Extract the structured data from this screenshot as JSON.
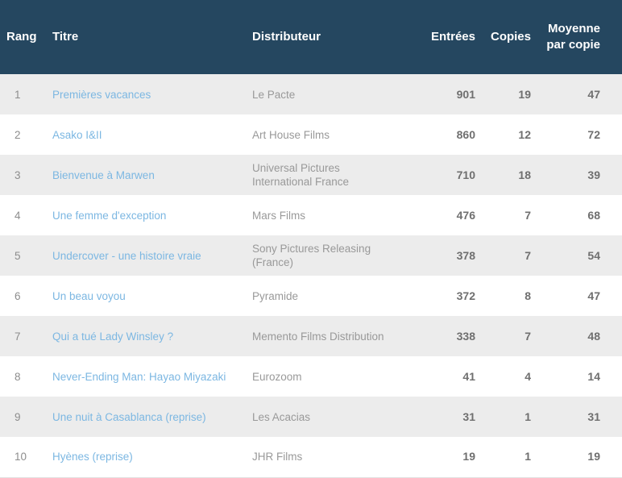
{
  "table": {
    "columns": {
      "rang": "Rang",
      "titre": "Titre",
      "distributeur": "Distributeur",
      "entrees": "Entrées",
      "copies": "Copies",
      "moyenne_line1": "Moyenne",
      "moyenne_line2": "par copie"
    },
    "colors": {
      "header_bg": "#254760",
      "header_text": "#ffffff",
      "row_odd_bg": "#ececec",
      "row_even_bg": "#ffffff",
      "link": "#7cb7e2",
      "rank_text": "#8d8d8d",
      "distributor_text": "#999999",
      "number_text": "#6f6f6f"
    },
    "rows": [
      {
        "rang": "1",
        "titre": "Premières vacances",
        "distributeur": [
          "Le Pacte"
        ],
        "entrees": "901",
        "copies": "19",
        "moyenne": "47"
      },
      {
        "rang": "2",
        "titre": "Asako I&II",
        "distributeur": [
          "Art House Films"
        ],
        "entrees": "860",
        "copies": "12",
        "moyenne": "72"
      },
      {
        "rang": "3",
        "titre": "Bienvenue à Marwen",
        "distributeur": [
          "Universal Pictures",
          "International France"
        ],
        "entrees": "710",
        "copies": "18",
        "moyenne": "39"
      },
      {
        "rang": "4",
        "titre": "Une femme d'exception",
        "distributeur": [
          "Mars Films"
        ],
        "entrees": "476",
        "copies": "7",
        "moyenne": "68"
      },
      {
        "rang": "5",
        "titre": "Undercover - une histoire vraie",
        "distributeur": [
          "Sony Pictures Releasing",
          "(France)"
        ],
        "entrees": "378",
        "copies": "7",
        "moyenne": "54"
      },
      {
        "rang": "6",
        "titre": "Un beau voyou",
        "distributeur": [
          "Pyramide"
        ],
        "entrees": "372",
        "copies": "8",
        "moyenne": "47"
      },
      {
        "rang": "7",
        "titre": "Qui a tué Lady Winsley ?",
        "distributeur": [
          "Memento Films Distribution"
        ],
        "entrees": "338",
        "copies": "7",
        "moyenne": "48"
      },
      {
        "rang": "8",
        "titre": "Never-Ending Man: Hayao Miyazaki",
        "distributeur": [
          "Eurozoom"
        ],
        "entrees": "41",
        "copies": "4",
        "moyenne": "14"
      },
      {
        "rang": "9",
        "titre": "Une nuit à Casablanca (reprise)",
        "distributeur": [
          "Les Acacias"
        ],
        "entrees": "31",
        "copies": "1",
        "moyenne": "31"
      },
      {
        "rang": "10",
        "titre": "Hyènes (reprise)",
        "distributeur": [
          "JHR Films"
        ],
        "entrees": "19",
        "copies": "1",
        "moyenne": "19"
      }
    ]
  }
}
